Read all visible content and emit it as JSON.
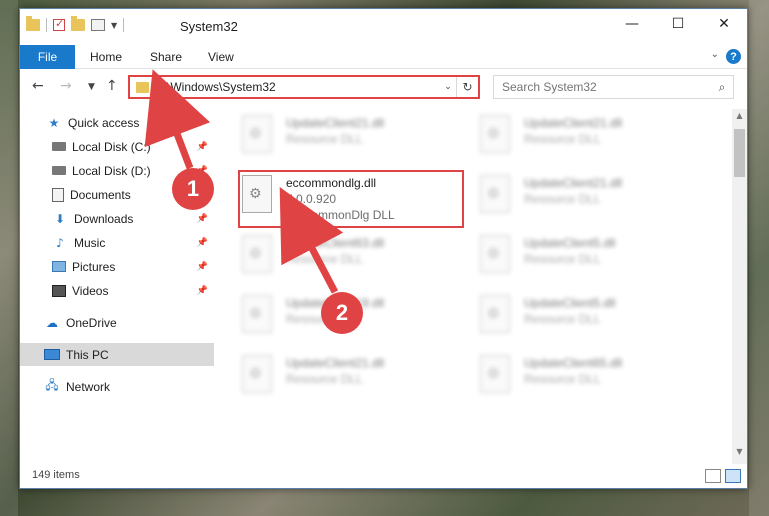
{
  "window": {
    "title": "System32",
    "controls": {
      "minimize": "—",
      "maximize": "☐",
      "close": "✕"
    }
  },
  "ribbon": {
    "tabs": [
      {
        "label": "File"
      },
      {
        "label": "Home"
      },
      {
        "label": "Share"
      },
      {
        "label": "View"
      }
    ],
    "help_label": "?"
  },
  "navigation": {
    "address_path": "C:\\Windows\\System32",
    "search_placeholder": "Search System32"
  },
  "sidebar": {
    "items": [
      {
        "label": "Quick access",
        "icon": "star-icon"
      },
      {
        "label": "Local Disk (C:)",
        "icon": "drive-icon",
        "pinned": true
      },
      {
        "label": "Local Disk (D:)",
        "icon": "drive-icon",
        "pinned": true
      },
      {
        "label": "Documents",
        "icon": "document-icon",
        "pinned": true
      },
      {
        "label": "Downloads",
        "icon": "download-icon",
        "pinned": true
      },
      {
        "label": "Music",
        "icon": "music-icon",
        "pinned": true
      },
      {
        "label": "Pictures",
        "icon": "picture-icon",
        "pinned": true
      },
      {
        "label": "Videos",
        "icon": "video-icon",
        "pinned": true
      },
      {
        "label": "OneDrive",
        "icon": "cloud-icon"
      },
      {
        "label": "This PC",
        "icon": "computer-icon",
        "selected": true
      },
      {
        "label": "Network",
        "icon": "network-icon"
      }
    ]
  },
  "files": {
    "highlighted": {
      "name": "eccommondlg.dll",
      "version": "7.0.0.920",
      "description": "ECCommonDlg DLL"
    },
    "blurred": [
      {
        "name": "UpdateClient21.dll",
        "desc": "Resource DLL"
      },
      {
        "name": "UpdateClient21.dll",
        "desc": "Resource DLL"
      },
      {
        "name": "UpdateClient21.dll",
        "desc": "Resource DLL"
      },
      {
        "name": "UpdateClient63.dll",
        "desc": "Resource DLL"
      },
      {
        "name": "UpdateClient5.dll",
        "desc": "Resource DLL"
      },
      {
        "name": "UpdateClient19.dll",
        "desc": "Resource DLL"
      },
      {
        "name": "UpdateClient5.dll",
        "desc": "Resource DLL"
      },
      {
        "name": "UpdateClient21.dll",
        "desc": "Resource DLL"
      },
      {
        "name": "UpdateClient65.dll",
        "desc": "Resource DLL"
      }
    ]
  },
  "status": {
    "item_count": "149 items"
  },
  "annotations": {
    "step1": "1",
    "step2": "2",
    "color": "#e04343"
  }
}
